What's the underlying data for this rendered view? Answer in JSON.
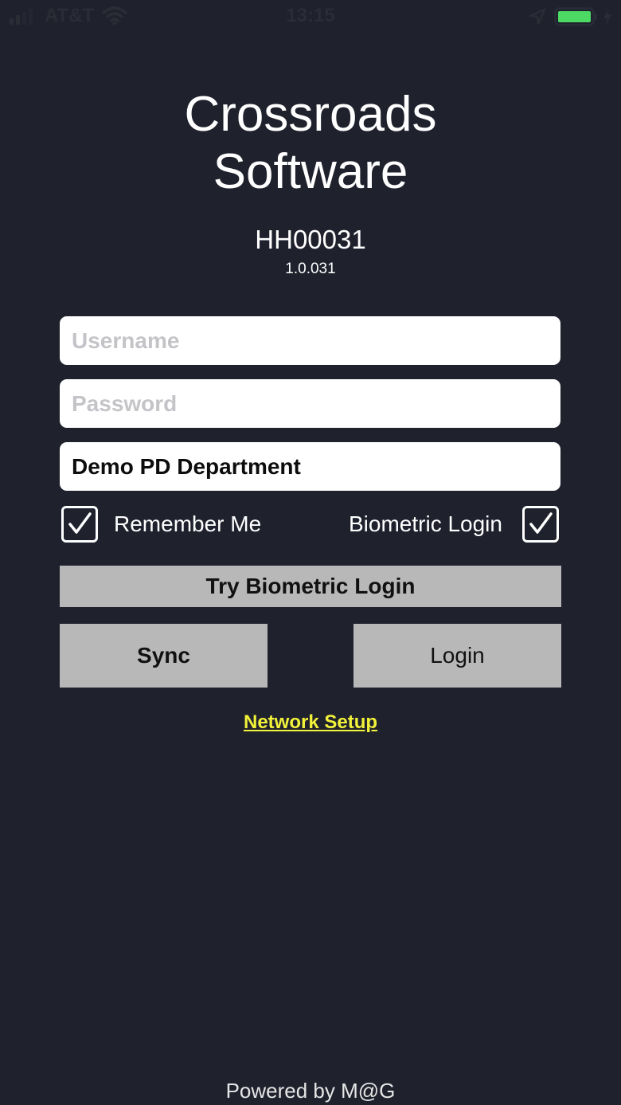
{
  "status_bar": {
    "carrier": "AT&T",
    "time": "13:15",
    "icons": [
      "signal-icon",
      "wifi-icon",
      "location-icon",
      "battery-icon",
      "charging-icon"
    ],
    "battery_color": "#4cd964"
  },
  "header": {
    "title_line1": "Crossroads",
    "title_line2": "Software",
    "device_id": "HH00031",
    "version": "1.0.031"
  },
  "form": {
    "username_placeholder": "Username",
    "password_placeholder": "Password",
    "department_value": "Demo PD Department",
    "remember_me_label": "Remember Me",
    "remember_me_checked": true,
    "biometric_label": "Biometric Login",
    "biometric_checked": true
  },
  "buttons": {
    "try_biometric": "Try Biometric Login",
    "sync": "Sync",
    "login": "Login"
  },
  "network_setup_link": "Network Setup",
  "footer": "Powered by M@G",
  "colors": {
    "background": "#1f212d",
    "button": "#b8b8b8",
    "link": "#f2f23a"
  }
}
